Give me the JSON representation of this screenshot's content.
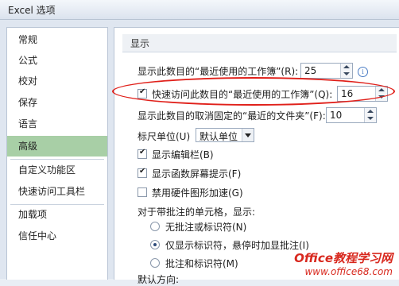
{
  "window": {
    "title": "Excel 选项"
  },
  "sidebar": {
    "items": [
      {
        "label": "常规"
      },
      {
        "label": "公式"
      },
      {
        "label": "校对"
      },
      {
        "label": "保存"
      },
      {
        "label": "语言"
      },
      {
        "label": "高级",
        "active": true
      },
      {
        "label": "自定义功能区"
      },
      {
        "label": "快速访问工具栏"
      },
      {
        "label": "加载项"
      },
      {
        "label": "信任中心"
      }
    ]
  },
  "main": {
    "section_title": "显示",
    "recent_workbooks": {
      "label": "显示此数目的“最近使用的工作簿”(R):",
      "value": "25"
    },
    "quick_access": {
      "label": "快速访问此数目的“最近使用的工作簿”(Q):",
      "value": "16",
      "checked": true
    },
    "unpinned_folders": {
      "label": "显示此数目的取消固定的“最近的文件夹”(F):",
      "value": "10"
    },
    "ruler_units": {
      "label": "标尺单位(U)",
      "value": "默认单位"
    },
    "show_formula_bar": {
      "label": "显示编辑栏(B)",
      "checked": true
    },
    "show_function_tips": {
      "label": "显示函数屏幕提示(F)",
      "checked": true
    },
    "disable_hw_accel": {
      "label": "禁用硬件图形加速(G)",
      "checked": false
    },
    "comments_header": "对于带批注的单元格，显示:",
    "comment_options": [
      {
        "label": "无批注或标识符(N)",
        "selected": false
      },
      {
        "label": "仅显示标识符，悬停时加显批注(I)",
        "selected": true
      },
      {
        "label": "批注和标识符(M)",
        "selected": false
      }
    ],
    "default_direction": "默认方向:"
  },
  "watermark": {
    "logo": "Office教程学习网",
    "url": "www.office68.com"
  }
}
